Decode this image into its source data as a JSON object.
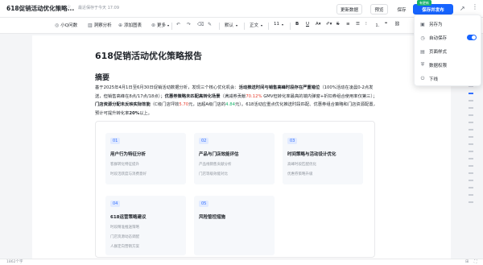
{
  "header": {
    "doc_title": "618促销活动优化策略...",
    "save_status": "最近保存于今天 17:09",
    "update_label": "更新数据",
    "preview_label": "预览",
    "save_label": "保存",
    "publish_label": "保存并发布",
    "new_badge": "有更新"
  },
  "toolbar": {
    "items": [
      {
        "label": "小Q问数"
      },
      {
        "label": "洞察分析"
      },
      {
        "label": "添加图表"
      },
      {
        "label": "更多"
      }
    ],
    "style_select": "默认",
    "para_select": "正文",
    "size_select": "11"
  },
  "document": {
    "title": "618促销活动优化策略报告",
    "section_heading": "摘要",
    "para": {
      "p1": "基于2025年4月1日至6月30日促销活动数据分析，发现三个核心优化机会：",
      "p1b": "活动推送时间与销售高峰时段存在严重错位",
      "p2": "（100%活动在凌晨0-2点发送，但销售高峰在8点/17点/18点）；",
      "p2b": "优惠券策略未匹配高转化场景",
      "p3": "（满减券贡献",
      "p3r": "70.12%",
      "p4": " GMV但转化率最高的端内弹窗+折扣券组合使用率仅第三）；",
      "p4b": "门店资源分配未反映实际效能",
      "p5": "（C级门店坪效",
      "p5r": "5.70",
      "p6": "元，远超A级门店的",
      "p6g": "4.84",
      "p7": "元）。618活动应重点优化推送时段匹配、优惠券组合策略和门店资源配置，预计可提升转化率",
      "p7b": "20%",
      "p8": "以上。"
    },
    "cards": [
      {
        "num": "01",
        "title": "用户行为特征分析",
        "items": [
          "客群转化特征提升",
          "时段活跃度与消费意好"
        ]
      },
      {
        "num": "02",
        "title": "产品与门店效能评估",
        "items": [
          "产品线销售贡献分析",
          "门店等级效能对比"
        ]
      },
      {
        "num": "03",
        "title": "时间策略与活动设计优化",
        "items": [
          "高峰时段匹配优化",
          "优惠券策略升级"
        ]
      },
      {
        "num": "04",
        "title": "618运营策略建议",
        "items": [
          "时段精准推送策略",
          "门店资源动态调配",
          "人群定向营销方案"
        ]
      },
      {
        "num": "05",
        "title": "风险管控措施",
        "items": []
      }
    ]
  },
  "menu": {
    "items": [
      {
        "label": "另存为",
        "icon": "save-as-icon"
      },
      {
        "label": "自动保存",
        "icon": "auto-save-icon",
        "toggle": true
      },
      {
        "label": "页面样式",
        "icon": "page-style-icon"
      },
      {
        "label": "数据权限",
        "icon": "data-permission-icon"
      },
      {
        "label": "下线",
        "icon": "offline-icon"
      }
    ]
  },
  "status": {
    "word_count": "1862个字"
  }
}
